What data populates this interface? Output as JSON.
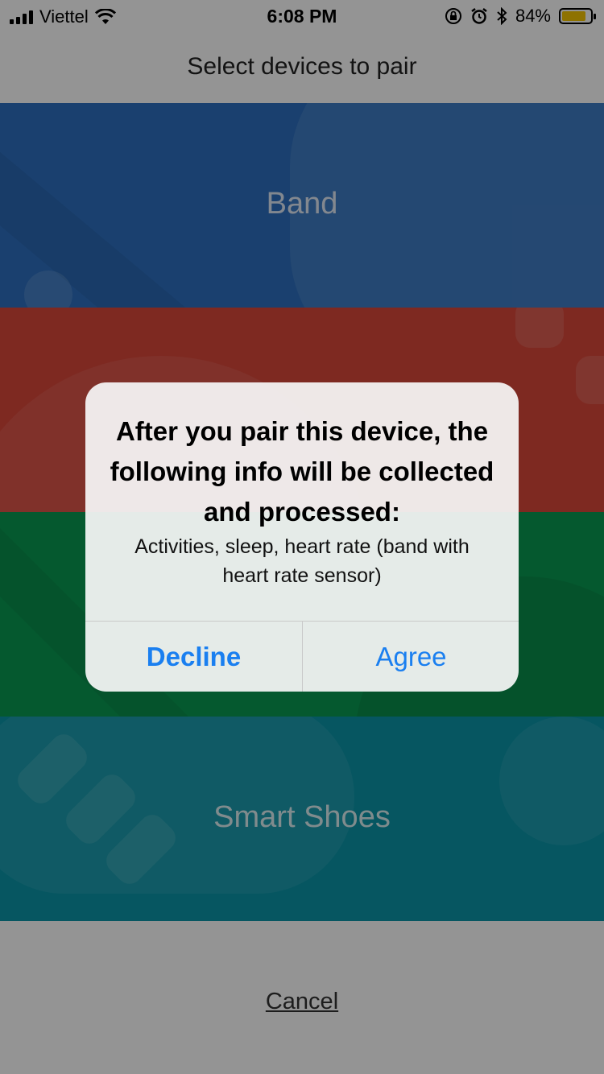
{
  "status_bar": {
    "carrier": "Viettel",
    "time": "6:08 PM",
    "battery_percent_text": "84%",
    "battery_level": 0.84,
    "icons": [
      "signal-icon",
      "wifi-icon",
      "orientation-lock-icon",
      "alarm-icon",
      "bluetooth-icon",
      "battery-icon"
    ]
  },
  "nav": {
    "title": "Select devices to pair"
  },
  "devices": [
    {
      "label": "Band",
      "color": "#2d6fbf"
    },
    {
      "label": "",
      "color": "#d9473a"
    },
    {
      "label": "",
      "color": "#0a9a52"
    },
    {
      "label": "Smart Shoes",
      "color": "#0b95a8"
    }
  ],
  "cancel": {
    "label": "Cancel"
  },
  "alert": {
    "title": "After you pair this device, the following info will be collected and processed:",
    "message": "Activities, sleep, heart rate (band with heart rate sensor)",
    "decline_label": "Decline",
    "agree_label": "Agree",
    "button_color": "#1a7ff0"
  }
}
